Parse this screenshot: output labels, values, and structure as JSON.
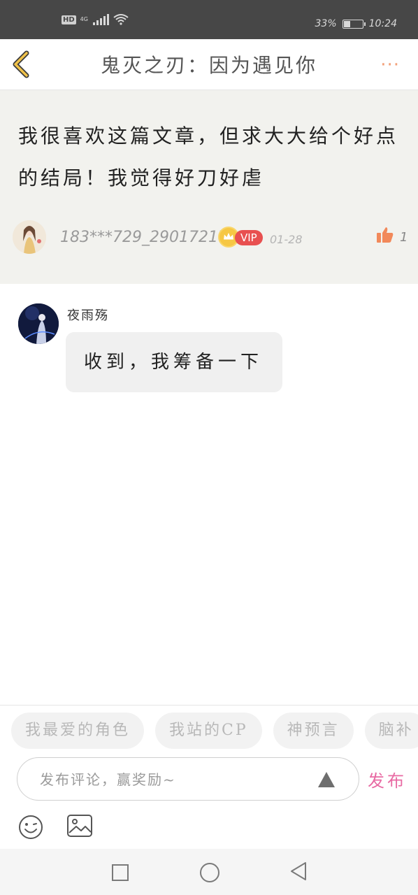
{
  "status_bar": {
    "hd": "HD",
    "network": "4G",
    "battery": "33%",
    "time": "10:24"
  },
  "header": {
    "title": "鬼灭之刃：因为遇见你",
    "more": "···"
  },
  "comment": {
    "text": "我很喜欢这篇文章，但求大大给个好点的结局！我觉得好刀好虐",
    "username": "183***729_290172179",
    "vip": "VIP",
    "date": "01-28",
    "like_count": "1"
  },
  "reply": {
    "name": "夜雨殇",
    "text": "收到，我筹备一下"
  },
  "chips": [
    "我最爱的角色",
    "我站的CP",
    "神预言",
    "脑补"
  ],
  "input": {
    "placeholder": "发布评论，赢奖励~",
    "publish_label": "发布"
  },
  "colors": {
    "status_bar": "#474747",
    "card_bg": "#f2f2ee",
    "vip": "#e85050",
    "like": "#f2895a",
    "publish": "#e86aa3",
    "more": "#f2a079",
    "back": "#f0c24a"
  },
  "icons": [
    "back-arrow-icon",
    "more-icon",
    "crown-icon",
    "thumbs-up-icon",
    "triangle-icon",
    "emoji-icon",
    "image-icon",
    "nav-square-icon",
    "nav-home-icon",
    "nav-back-icon"
  ]
}
